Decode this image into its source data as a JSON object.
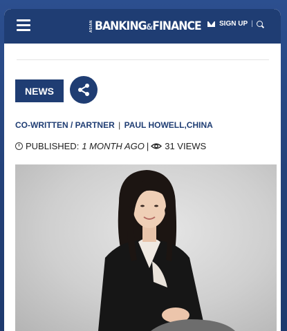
{
  "header": {
    "logo_small": "ASIAN",
    "logo_main_a": "BANKING",
    "logo_amp": "&",
    "logo_main_b": "FINANCE",
    "signup_label": "SIGN UP",
    "separator": "|"
  },
  "article": {
    "category_label": "NEWS",
    "byline_type": "CO-WRITTEN / PARTNER",
    "byline_sep": "|",
    "byline_author": "PAUL HOWELL,CHINA",
    "published_label": "PUBLISHED:",
    "published_value": "1 MONTH AGO",
    "meta_sep": "|",
    "views_label": "31 VIEWS"
  },
  "colors": {
    "brand": "#1f3d73",
    "background": "#2a4a86"
  },
  "icons": [
    "hamburger-menu-icon",
    "mail-icon",
    "search-icon",
    "share-icon",
    "clock-icon",
    "eye-icon"
  ]
}
